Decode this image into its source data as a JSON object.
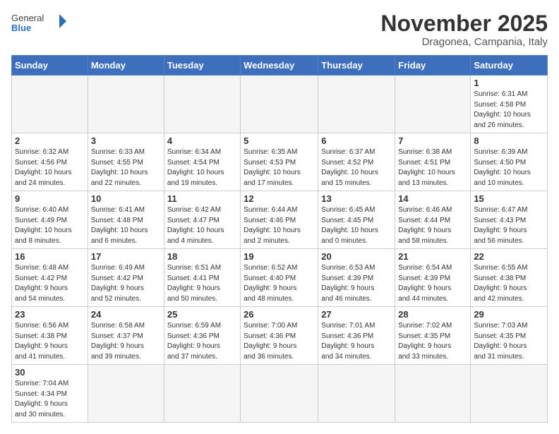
{
  "header": {
    "logo_general": "General",
    "logo_blue": "Blue",
    "main_title": "November 2025",
    "sub_title": "Dragonea, Campania, Italy"
  },
  "weekdays": [
    "Sunday",
    "Monday",
    "Tuesday",
    "Wednesday",
    "Thursday",
    "Friday",
    "Saturday"
  ],
  "weeks": [
    [
      {
        "day": "",
        "info": ""
      },
      {
        "day": "",
        "info": ""
      },
      {
        "day": "",
        "info": ""
      },
      {
        "day": "",
        "info": ""
      },
      {
        "day": "",
        "info": ""
      },
      {
        "day": "",
        "info": ""
      },
      {
        "day": "1",
        "info": "Sunrise: 6:31 AM\nSunset: 4:58 PM\nDaylight: 10 hours\nand 26 minutes."
      }
    ],
    [
      {
        "day": "2",
        "info": "Sunrise: 6:32 AM\nSunset: 4:56 PM\nDaylight: 10 hours\nand 24 minutes."
      },
      {
        "day": "3",
        "info": "Sunrise: 6:33 AM\nSunset: 4:55 PM\nDaylight: 10 hours\nand 22 minutes."
      },
      {
        "day": "4",
        "info": "Sunrise: 6:34 AM\nSunset: 4:54 PM\nDaylight: 10 hours\nand 19 minutes."
      },
      {
        "day": "5",
        "info": "Sunrise: 6:35 AM\nSunset: 4:53 PM\nDaylight: 10 hours\nand 17 minutes."
      },
      {
        "day": "6",
        "info": "Sunrise: 6:37 AM\nSunset: 4:52 PM\nDaylight: 10 hours\nand 15 minutes."
      },
      {
        "day": "7",
        "info": "Sunrise: 6:38 AM\nSunset: 4:51 PM\nDaylight: 10 hours\nand 13 minutes."
      },
      {
        "day": "8",
        "info": "Sunrise: 6:39 AM\nSunset: 4:50 PM\nDaylight: 10 hours\nand 10 minutes."
      }
    ],
    [
      {
        "day": "9",
        "info": "Sunrise: 6:40 AM\nSunset: 4:49 PM\nDaylight: 10 hours\nand 8 minutes."
      },
      {
        "day": "10",
        "info": "Sunrise: 6:41 AM\nSunset: 4:48 PM\nDaylight: 10 hours\nand 6 minutes."
      },
      {
        "day": "11",
        "info": "Sunrise: 6:42 AM\nSunset: 4:47 PM\nDaylight: 10 hours\nand 4 minutes."
      },
      {
        "day": "12",
        "info": "Sunrise: 6:44 AM\nSunset: 4:46 PM\nDaylight: 10 hours\nand 2 minutes."
      },
      {
        "day": "13",
        "info": "Sunrise: 6:45 AM\nSunset: 4:45 PM\nDaylight: 10 hours\nand 0 minutes."
      },
      {
        "day": "14",
        "info": "Sunrise: 6:46 AM\nSunset: 4:44 PM\nDaylight: 9 hours\nand 58 minutes."
      },
      {
        "day": "15",
        "info": "Sunrise: 6:47 AM\nSunset: 4:43 PM\nDaylight: 9 hours\nand 56 minutes."
      }
    ],
    [
      {
        "day": "16",
        "info": "Sunrise: 6:48 AM\nSunset: 4:42 PM\nDaylight: 9 hours\nand 54 minutes."
      },
      {
        "day": "17",
        "info": "Sunrise: 6:49 AM\nSunset: 4:42 PM\nDaylight: 9 hours\nand 52 minutes."
      },
      {
        "day": "18",
        "info": "Sunrise: 6:51 AM\nSunset: 4:41 PM\nDaylight: 9 hours\nand 50 minutes."
      },
      {
        "day": "19",
        "info": "Sunrise: 6:52 AM\nSunset: 4:40 PM\nDaylight: 9 hours\nand 48 minutes."
      },
      {
        "day": "20",
        "info": "Sunrise: 6:53 AM\nSunset: 4:39 PM\nDaylight: 9 hours\nand 46 minutes."
      },
      {
        "day": "21",
        "info": "Sunrise: 6:54 AM\nSunset: 4:39 PM\nDaylight: 9 hours\nand 44 minutes."
      },
      {
        "day": "22",
        "info": "Sunrise: 6:55 AM\nSunset: 4:38 PM\nDaylight: 9 hours\nand 42 minutes."
      }
    ],
    [
      {
        "day": "23",
        "info": "Sunrise: 6:56 AM\nSunset: 4:38 PM\nDaylight: 9 hours\nand 41 minutes."
      },
      {
        "day": "24",
        "info": "Sunrise: 6:58 AM\nSunset: 4:37 PM\nDaylight: 9 hours\nand 39 minutes."
      },
      {
        "day": "25",
        "info": "Sunrise: 6:59 AM\nSunset: 4:36 PM\nDaylight: 9 hours\nand 37 minutes."
      },
      {
        "day": "26",
        "info": "Sunrise: 7:00 AM\nSunset: 4:36 PM\nDaylight: 9 hours\nand 36 minutes."
      },
      {
        "day": "27",
        "info": "Sunrise: 7:01 AM\nSunset: 4:36 PM\nDaylight: 9 hours\nand 34 minutes."
      },
      {
        "day": "28",
        "info": "Sunrise: 7:02 AM\nSunset: 4:35 PM\nDaylight: 9 hours\nand 33 minutes."
      },
      {
        "day": "29",
        "info": "Sunrise: 7:03 AM\nSunset: 4:35 PM\nDaylight: 9 hours\nand 31 minutes."
      }
    ],
    [
      {
        "day": "30",
        "info": "Sunrise: 7:04 AM\nSunset: 4:34 PM\nDaylight: 9 hours\nand 30 minutes."
      },
      {
        "day": "",
        "info": ""
      },
      {
        "day": "",
        "info": ""
      },
      {
        "day": "",
        "info": ""
      },
      {
        "day": "",
        "info": ""
      },
      {
        "day": "",
        "info": ""
      },
      {
        "day": "",
        "info": ""
      }
    ]
  ]
}
